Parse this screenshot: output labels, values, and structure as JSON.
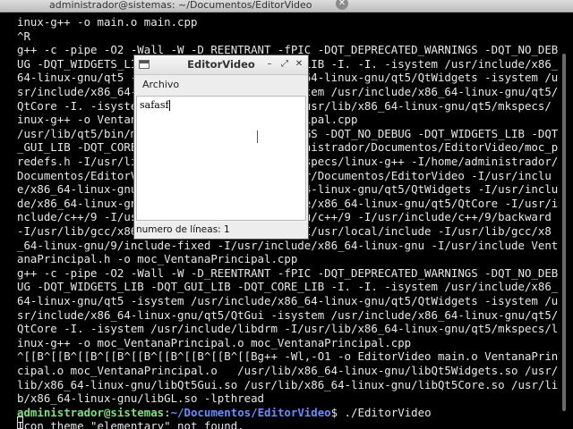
{
  "terminal": {
    "title": "administrador@sistemas: ~/Documentos/EditorVideo",
    "close_glyph": "✕",
    "lines": [
      "inux-g++ -o main.o main.cpp",
      "^R",
      "g++ -c -pipe -O2 -Wall -W -D_REENTRANT -fPIC -DQT_DEPRECATED_WARNINGS -DQT_NO_DEB",
      "UG -DQT_WIDGETS_LIB -DQT_GUI_LIB -DQT_CORE_LIB -I. -I. -isystem /usr/include/x86_",
      "64-linux-gnu/qt5 -isystem /usr/include/x86_64-linux-gnu/qt5/QtWidgets -isystem /u",
      "sr/include/x86_64-linux-gnu/qt5/QtGui -isystem /usr/include/x86_64-linux-gnu/qt5/",
      "QtCore -I. -isystem /usr/include/libdrm -I/usr/lib/x86_64-linux-gnu/qt5/mkspecs/",
      "inux-g++ -o VentanaPrincipal.o VentanaPrincipal.cpp",
      "/usr/lib/qt5/bin/moc -DQT_DEPRECATED_WARNINGS -DQT_NO_DEBUG -DQT_WIDGETS_LIB -DQT",
      "_GUI_LIB -DQT_CORE_LIB --include /home/administrador/Documentos/EditorVideo/moc_p",
      "redefs.h -I/usr/lib/x86_64-linux-gnu/qt5/mkspecs/linux-g++ -I/home/administrador/",
      "Documentos/EditorVideo -I/home/administrador/Documentos/EditorVideo -I/usr/inclu",
      "e/x86_64-linux-gnu/qt5 -I/usr/include/x86_64-linux-gnu/qt5/QtWidgets -I/usr/inclu",
      "de/x86_64-linux-gnu/qt5/QtGui -I/usr/include/x86_64-linux-gnu/qt5/QtCore -I/usr/i",
      "nclude/c++/9 -I/usr/include/x86_64-linux-gnu/c++/9 -I/usr/include/c++/9/backward",
      "-I/usr/lib/gcc/x86_64-linux-gnu/9/include -I/usr/local/include -I/usr/lib/gcc/x8",
      "_64-linux-gnu/9/include-fixed -I/usr/include/x86_64-linux-gnu -I/usr/include Vent",
      "anaPrincipal.h -o moc_VentanaPrincipal.cpp",
      "g++ -c -pipe -O2 -Wall -W -D_REENTRANT -fPIC -DQT_DEPRECATED_WARNINGS -DQT_NO_DEB",
      "UG -DQT_WIDGETS_LIB -DQT_GUI_LIB -DQT_CORE_LIB -I. -I. -isystem /usr/include/x86_",
      "64-linux-gnu/qt5 -isystem /usr/include/x86_64-linux-gnu/qt5/QtWidgets -isystem /u",
      "sr/include/x86_64-linux-gnu/qt5/QtGui -isystem /usr/include/x86_64-linux-gnu/qt5/",
      "QtCore -I. -isystem /usr/include/libdrm -I/usr/lib/x86_64-linux-gnu/qt5/mkspecs/l",
      "inux-g++ -o moc_VentanaPrincipal.o moc_VentanaPrincipal.cpp",
      "^[[B^[[B^[[B^[[B^[[B^[[B^[[B^[[B^[[Bg++ -Wl,-O1 -o EditorVideo main.o VentanaPrin",
      "cipal.o moc_VentanaPrincipal.o   /usr/lib/x86_64-linux-gnu/libQt5Widgets.so /usr/",
      "lib/x86_64-linux-gnu/libQt5Gui.so /usr/lib/x86_64-linux-gnu/libQt5Core.so /usr/li",
      "b/x86_64-linux-gnu/libGL.so -lpthread"
    ],
    "prompt": {
      "user": "administrador@sistemas",
      "sep": ":",
      "path": "~/Documentos/EditorVideo",
      "command": "$ ./EditorVideo"
    },
    "last_line": "Icon theme \"elementary\" not found."
  },
  "editor_window": {
    "title": "EditorVideo",
    "btn_min": "–",
    "btn_max": "⤢",
    "btn_close": "✕",
    "menu": [
      "Archivo"
    ],
    "text": "safasf",
    "status": "numero de líneas: 1"
  }
}
